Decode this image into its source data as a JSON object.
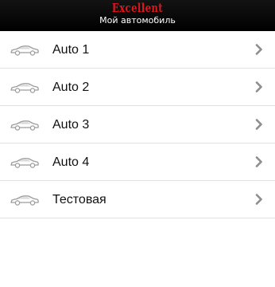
{
  "header": {
    "brand": "Excellent",
    "title": "Мой автомобиль"
  },
  "colors": {
    "header_bg": "#000000",
    "brand": "#e0161d",
    "icon": "#9c9c9c",
    "chevron": "#8d8d8d",
    "divider": "#e1e1e1"
  },
  "list": {
    "items": [
      {
        "label": "Auto 1",
        "icon": "car-icon"
      },
      {
        "label": "Auto 2",
        "icon": "car-icon"
      },
      {
        "label": "Auto 3",
        "icon": "car-icon"
      },
      {
        "label": "Auto 4",
        "icon": "car-icon"
      },
      {
        "label": "Тестовая",
        "icon": "car-icon"
      }
    ]
  }
}
